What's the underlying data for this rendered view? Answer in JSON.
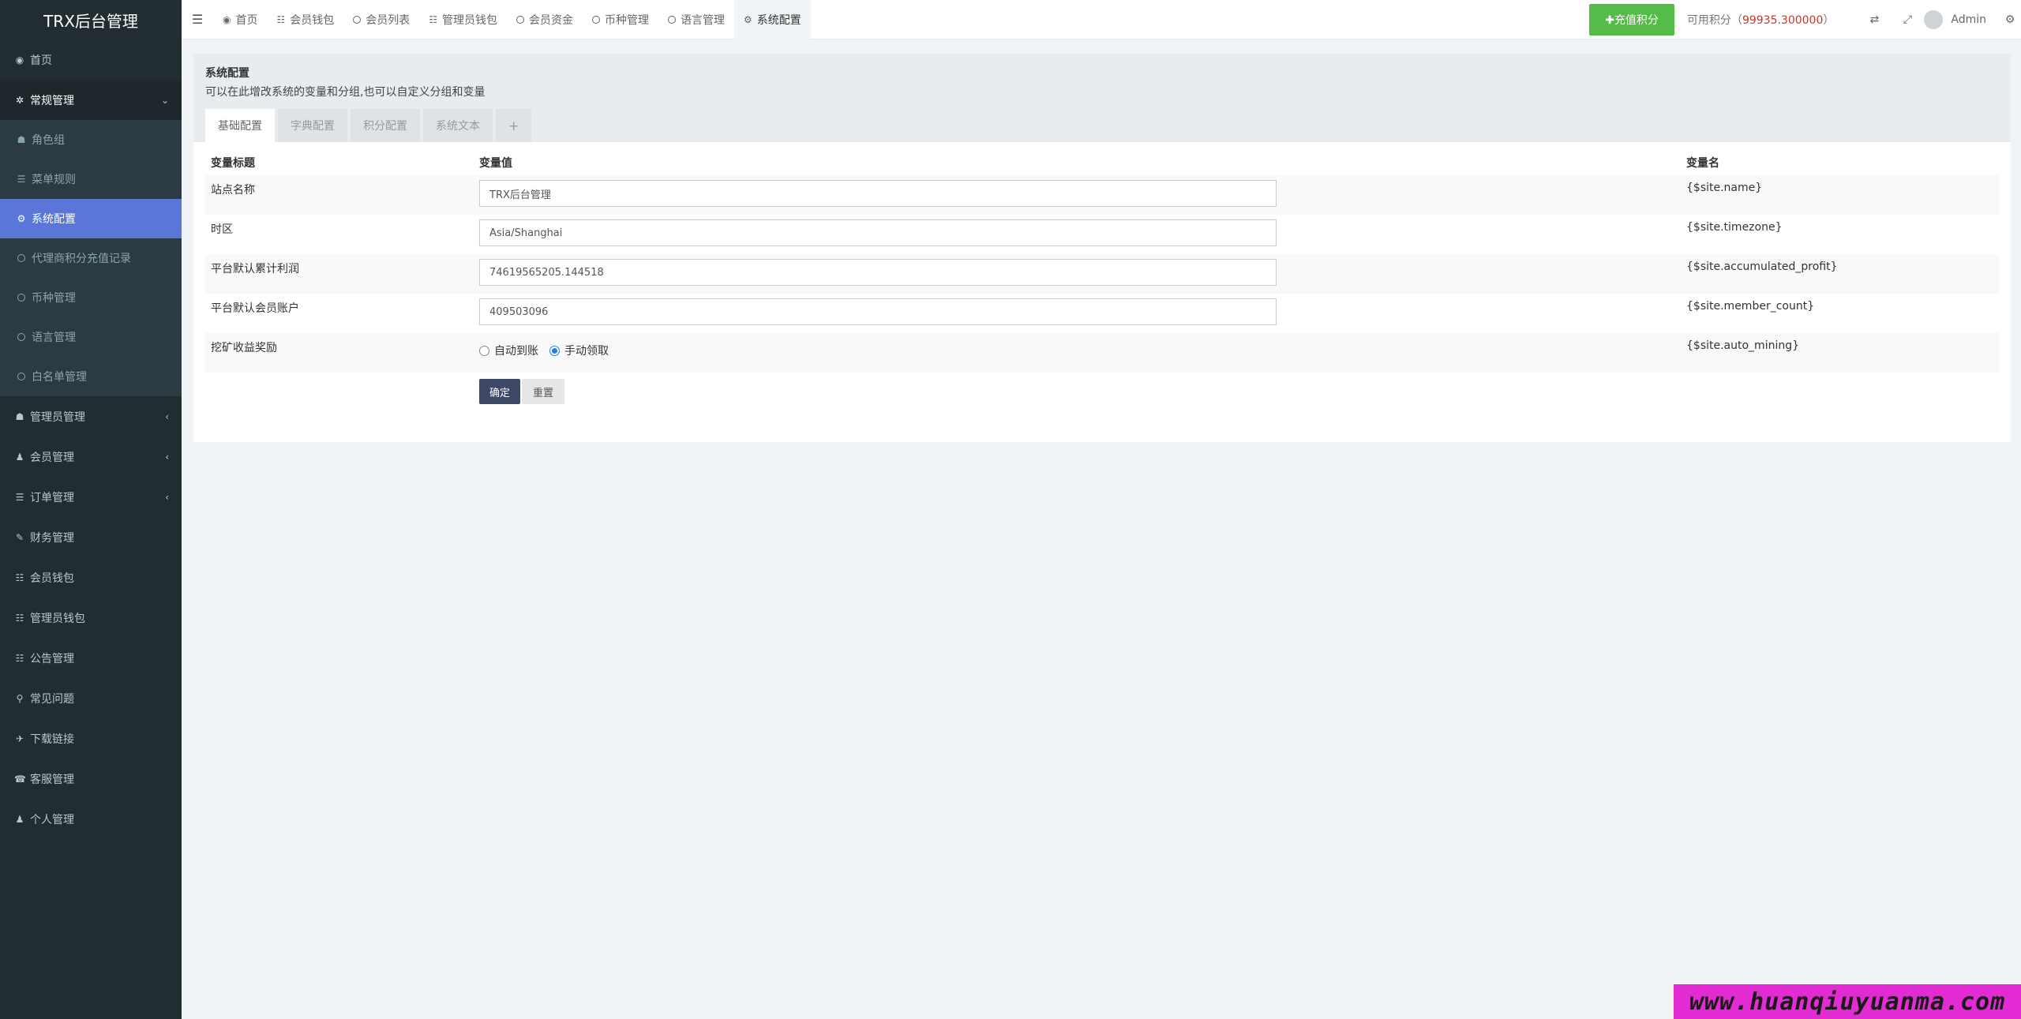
{
  "app_title": "TRX后台管理",
  "sidebar": {
    "items_top": [
      {
        "label": "首页",
        "icon": "dashboard-icon"
      },
      {
        "label": "常规管理",
        "icon": "cogs-icon"
      }
    ],
    "submenu": [
      {
        "label": "角色组",
        "icon": "group-icon"
      },
      {
        "label": "菜单规则",
        "icon": "list-icon"
      },
      {
        "label": "系统配置",
        "icon": "gear-icon",
        "active": true
      },
      {
        "label": "代理商积分充值记录",
        "icon": "circle-icon"
      },
      {
        "label": "币种管理",
        "icon": "circle-icon"
      },
      {
        "label": "语言管理",
        "icon": "circle-icon"
      },
      {
        "label": "白名单管理",
        "icon": "circle-icon"
      }
    ],
    "items_bottom": [
      {
        "label": "管理员管理",
        "icon": "group-icon"
      },
      {
        "label": "会员管理",
        "icon": "user-icon"
      },
      {
        "label": "订单管理",
        "icon": "list-icon"
      },
      {
        "label": "财务管理",
        "icon": "edit-icon"
      },
      {
        "label": "会员钱包",
        "icon": "table-icon"
      },
      {
        "label": "管理员钱包",
        "icon": "table-icon"
      },
      {
        "label": "公告管理",
        "icon": "table-icon"
      },
      {
        "label": "常见问题",
        "icon": "search-icon"
      },
      {
        "label": "下载链接",
        "icon": "plane-icon"
      },
      {
        "label": "客服管理",
        "icon": "phone-icon"
      },
      {
        "label": "个人管理",
        "icon": "user-icon"
      }
    ]
  },
  "topnav": {
    "tabs": [
      {
        "label": "首页",
        "icon": "dashboard-icon"
      },
      {
        "label": "会员钱包",
        "icon": "table-icon"
      },
      {
        "label": "会员列表",
        "icon": "circle-icon"
      },
      {
        "label": "管理员钱包",
        "icon": "table-icon"
      },
      {
        "label": "会员资金",
        "icon": "circle-icon"
      },
      {
        "label": "币种管理",
        "icon": "circle-icon"
      },
      {
        "label": "语言管理",
        "icon": "circle-icon"
      },
      {
        "label": "系统配置",
        "icon": "gear-icon",
        "active": true
      }
    ],
    "recharge_label": "✚充值积分",
    "points_prefix": "可用积分（",
    "points_value": "99935.300000",
    "points_suffix": "）",
    "user_name": "Admin"
  },
  "panel": {
    "title": "系统配置",
    "description": "可以在此增改系统的变量和分组,也可以自定义分组和变量",
    "tabs": [
      "基础配置",
      "字典配置",
      "积分配置",
      "系统文本",
      "+"
    ]
  },
  "table": {
    "headers": [
      "变量标题",
      "变量值",
      "变量名"
    ],
    "rows": [
      {
        "title": "站点名称",
        "value": "TRX后台管理",
        "name": "{$site.name}"
      },
      {
        "title": "时区",
        "value": "Asia/Shanghai",
        "name": "{$site.timezone}"
      },
      {
        "title": "平台默认累计利润",
        "value": "74619565205.144518",
        "name": "{$site.accumulated_profit}"
      },
      {
        "title": "平台默认会员账户",
        "value": "409503096",
        "name": "{$site.member_count}"
      },
      {
        "title": "挖矿收益奖励",
        "radio_options": [
          "自动到账",
          "手动领取"
        ],
        "radio_selected": 1,
        "name": "{$site.auto_mining}"
      }
    ],
    "confirm_label": "确定",
    "reset_label": "重置"
  },
  "watermark": "www.huanqiuyuanma.com",
  "colors": {
    "sidebar_bg": "#222d32",
    "active_item": "#5a76d8",
    "recharge_btn": "#55bd47",
    "points_value": "#c0392b",
    "confirm_btn": "#3d4766",
    "watermark_bg": "#e32bd4"
  }
}
